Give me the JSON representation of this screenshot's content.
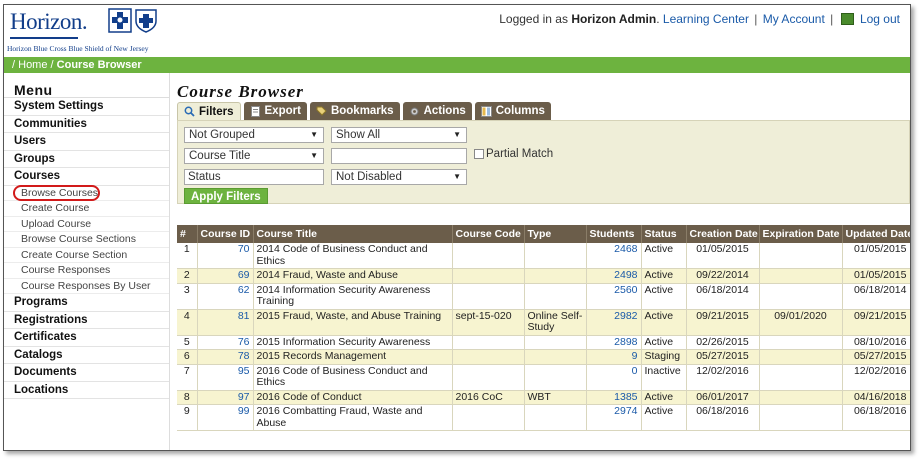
{
  "header": {
    "logo_text": "Horizon.",
    "logo_sub": "Horizon Blue Cross Blue Shield of New Jersey",
    "logged_in_prefix": "Logged in as",
    "user_name": "Horizon Admin",
    "link_learning": "Learning Center",
    "link_account": "My Account",
    "link_logout": "Log out",
    "separator": "|"
  },
  "breadcrumb": {
    "sep": "/",
    "home": "Home",
    "current": "Course Browser"
  },
  "sidebar": {
    "title": "Menu",
    "items_top": [
      "System Settings",
      "Communities",
      "Users",
      "Groups",
      "Courses"
    ],
    "sub_items": [
      "Browse Courses",
      "Create Course",
      "Upload Course",
      "Browse Course Sections",
      "Create Course Section",
      "Course Responses",
      "Course Responses By User"
    ],
    "items_bottom": [
      "Programs",
      "Registrations",
      "Certificates",
      "Catalogs",
      "Documents",
      "Locations"
    ]
  },
  "main": {
    "title": "Course Browser",
    "tabs": [
      "Filters",
      "Export",
      "Bookmarks",
      "Actions",
      "Columns"
    ],
    "filters": {
      "group_by": "Not Grouped",
      "show": "Show All",
      "field": "Course Title",
      "search_value": "",
      "partial_match": "Partial Match",
      "status_label": "Status",
      "disabled": "Not Disabled",
      "apply": "Apply Filters"
    },
    "columns": [
      "#",
      "Course ID",
      "Course Title",
      "Course Code",
      "Type",
      "Students",
      "Status",
      "Creation Date",
      "Expiration Date",
      "Updated Date"
    ],
    "rows": [
      [
        "1",
        "70",
        "2014 Code of Business Conduct and Ethics",
        "",
        "",
        "2468",
        "Active",
        "01/05/2015",
        "",
        "01/05/2015"
      ],
      [
        "2",
        "69",
        "2014 Fraud, Waste and Abuse",
        "",
        "",
        "2498",
        "Active",
        "09/22/2014",
        "",
        "01/05/2015"
      ],
      [
        "3",
        "62",
        "2014 Information Security Awareness Training",
        "",
        "",
        "2560",
        "Active",
        "06/18/2014",
        "",
        "06/18/2014"
      ],
      [
        "4",
        "81",
        "2015 Fraud, Waste, and Abuse Training",
        "sept-15-020",
        "Online Self-Study",
        "2982",
        "Active",
        "09/21/2015",
        "09/01/2020",
        "09/21/2015"
      ],
      [
        "5",
        "76",
        "2015 Information Security Awareness",
        "",
        "",
        "2898",
        "Active",
        "02/26/2015",
        "",
        "08/10/2016"
      ],
      [
        "6",
        "78",
        "2015 Records Management",
        "",
        "",
        "9",
        "Staging",
        "05/27/2015",
        "",
        "05/27/2015"
      ],
      [
        "7",
        "95",
        "2016 Code of Business Conduct and Ethics",
        "",
        "",
        "0",
        "Inactive",
        "12/02/2016",
        "",
        "12/02/2016"
      ],
      [
        "8",
        "97",
        "2016 Code of Conduct",
        "2016 CoC",
        "WBT",
        "1385",
        "Active",
        "06/01/2017",
        "",
        "04/16/2018"
      ],
      [
        "9",
        "99",
        "2016 Combatting Fraud, Waste and Abuse",
        "",
        "",
        "2974",
        "Active",
        "06/18/2016",
        "",
        "06/18/2016"
      ]
    ]
  },
  "colors": {
    "brand_blue": "#123e8a",
    "accent_green": "#6db33f",
    "table_header": "#6b5d4a",
    "row_alt": "#f7f4d0",
    "highlight_circle": "#d21a1a"
  }
}
